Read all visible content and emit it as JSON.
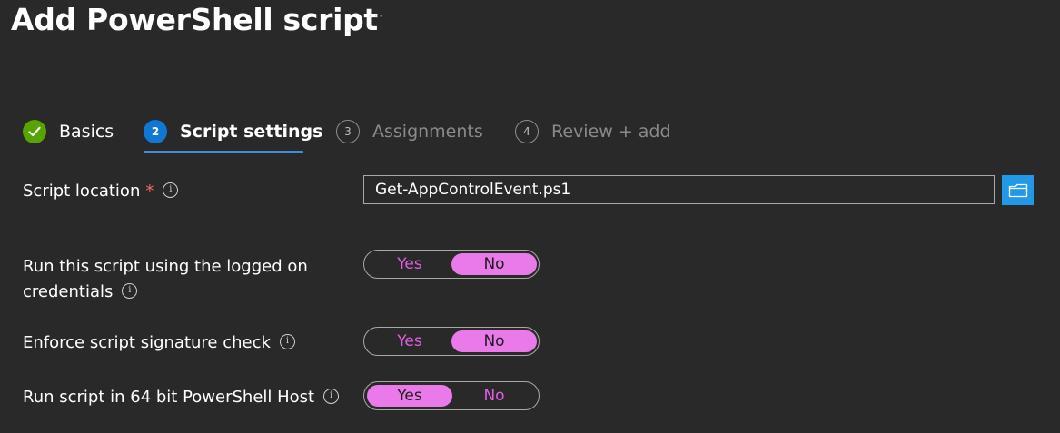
{
  "header": {
    "title": "Add PowerShell script",
    "more_label": "···"
  },
  "steps": [
    {
      "number": "",
      "label": "Basics",
      "state": "completed"
    },
    {
      "number": "2",
      "label": "Script settings",
      "state": "current"
    },
    {
      "number": "3",
      "label": "Assignments",
      "state": "upcoming"
    },
    {
      "number": "4",
      "label": "Review + add",
      "state": "upcoming"
    }
  ],
  "form": {
    "script_location": {
      "label": "Script location",
      "required_mark": "*",
      "value": "Get-AppControlEvent.ps1"
    },
    "run_logged_on": {
      "label_line1": "Run this script using the logged on",
      "label_line2": "credentials",
      "yes": "Yes",
      "no": "No",
      "selected": "No"
    },
    "enforce_signature": {
      "label": "Enforce script signature check",
      "yes": "Yes",
      "no": "No",
      "selected": "No"
    },
    "run_64bit": {
      "label": "Run script in 64 bit PowerShell Host",
      "yes": "Yes",
      "no": "No",
      "selected": "Yes"
    }
  },
  "colors": {
    "background": "#292929",
    "accent_blue": "#0f78d4",
    "success_green": "#57a300",
    "toggle_pink": "#ea79ea",
    "required_red": "#f06c6c"
  }
}
